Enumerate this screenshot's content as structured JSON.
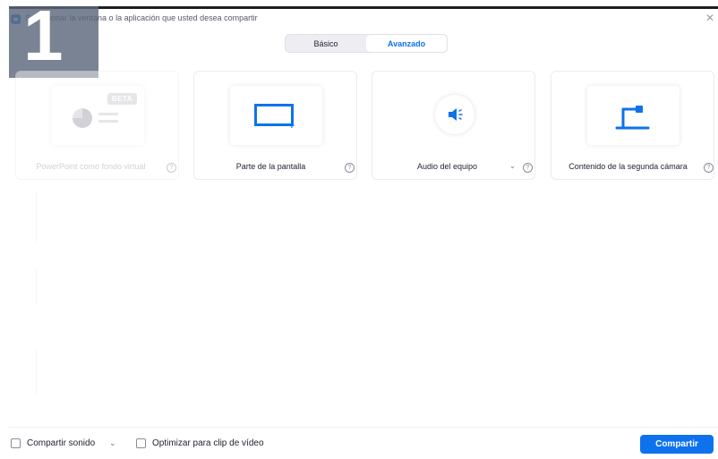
{
  "window": {
    "title": "Seleccionar la ventana o la aplicación que usted desea compartir",
    "close_glyph": "✕"
  },
  "overlay": {
    "step_number": "1"
  },
  "tabs": [
    {
      "label": "Básico",
      "active": false
    },
    {
      "label": "Avanzado",
      "active": true
    }
  ],
  "options": [
    {
      "label": "PowerPoint como fondo virtual",
      "badge": "BETA",
      "icon": "powerpoint-icon",
      "enabled": false
    },
    {
      "label": "Parte de la pantalla",
      "icon": "screen-portion-icon",
      "enabled": true
    },
    {
      "label": "Audio del equipo",
      "icon": "speaker-icon",
      "enabled": true,
      "has_dropdown": true
    },
    {
      "label": "Contenido de la segunda cámara",
      "icon": "document-camera-icon",
      "enabled": true
    }
  ],
  "help_glyph": "?",
  "dropdown_glyph": "⌄",
  "footer": {
    "share_sound_label": "Compartir sonido",
    "optimize_video_label": "Optimizar para clip de vídeo",
    "share_button": "Compartir"
  },
  "colors": {
    "accent": "#0e72ed",
    "text": "#232333"
  }
}
